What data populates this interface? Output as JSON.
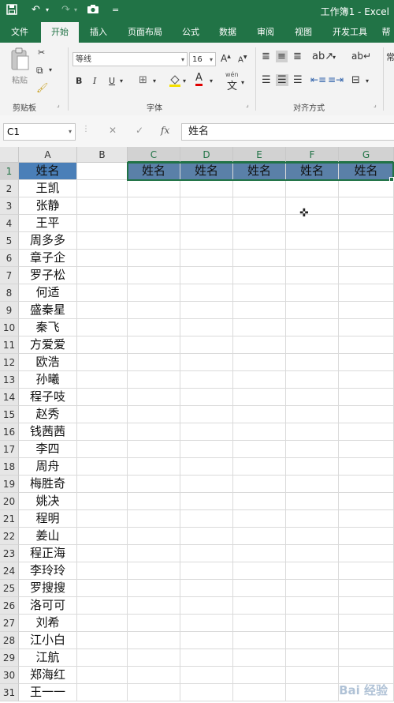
{
  "window": {
    "title": "工作簿1 - Excel"
  },
  "quick_access": {
    "save_icon": "save-icon",
    "undo_icon": "undo-icon",
    "redo_icon": "redo-icon",
    "camera_icon": "camera-icon",
    "customize": "="
  },
  "tabs": [
    "文件",
    "开始",
    "插入",
    "页面布局",
    "公式",
    "数据",
    "审阅",
    "视图",
    "开发工具",
    "帮"
  ],
  "ribbon": {
    "clipboard": {
      "paste": "粘贴",
      "label": "剪贴板"
    },
    "font": {
      "name": "等线",
      "size": "16",
      "grow": "A",
      "shrink": "A",
      "bold": "B",
      "italic": "I",
      "underline": "U",
      "color_letter": "A",
      "phonetic": "wén",
      "label": "字体"
    },
    "alignment": {
      "label": "对齐方式"
    }
  },
  "formula_bar": {
    "name_box": "C1",
    "cancel": "✕",
    "enter": "✓",
    "fx": "fx",
    "content": "姓名"
  },
  "columns": [
    "A",
    "B",
    "C",
    "D",
    "E",
    "F",
    "G"
  ],
  "rows": [
    {
      "n": "1",
      "a": "姓名"
    },
    {
      "n": "2",
      "a": "王凯"
    },
    {
      "n": "3",
      "a": "张静"
    },
    {
      "n": "4",
      "a": "王平"
    },
    {
      "n": "5",
      "a": "周多多"
    },
    {
      "n": "6",
      "a": "章子企"
    },
    {
      "n": "7",
      "a": "罗子松"
    },
    {
      "n": "8",
      "a": "何适"
    },
    {
      "n": "9",
      "a": "盛秦星"
    },
    {
      "n": "10",
      "a": "秦飞"
    },
    {
      "n": "11",
      "a": "方爱爱"
    },
    {
      "n": "12",
      "a": "欧浩"
    },
    {
      "n": "13",
      "a": "孙曦"
    },
    {
      "n": "14",
      "a": "程子吱"
    },
    {
      "n": "15",
      "a": "赵秀"
    },
    {
      "n": "16",
      "a": "钱茜茜"
    },
    {
      "n": "17",
      "a": "李四"
    },
    {
      "n": "18",
      "a": "周舟"
    },
    {
      "n": "19",
      "a": "梅胜奇"
    },
    {
      "n": "20",
      "a": "姚决"
    },
    {
      "n": "21",
      "a": "程明"
    },
    {
      "n": "22",
      "a": "姜山"
    },
    {
      "n": "23",
      "a": "程正海"
    },
    {
      "n": "24",
      "a": "李玲玲"
    },
    {
      "n": "25",
      "a": "罗搜搜"
    },
    {
      "n": "26",
      "a": "洛可可"
    },
    {
      "n": "27",
      "a": "刘希"
    },
    {
      "n": "28",
      "a": "江小白"
    },
    {
      "n": "29",
      "a": "江航"
    },
    {
      "n": "30",
      "a": "郑海红"
    },
    {
      "n": "31",
      "a": "王一一"
    }
  ],
  "row1_selected": [
    "姓名",
    "姓名",
    "姓名",
    "姓名",
    "姓名"
  ],
  "watermark": "Bai 经验",
  "colors": {
    "excel_green": "#217346",
    "header_fill": "#4a7fb8"
  }
}
